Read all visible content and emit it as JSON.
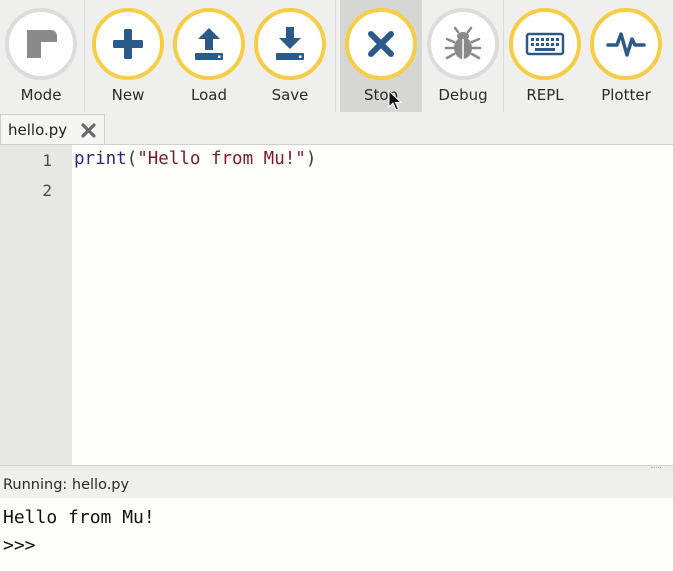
{
  "toolbar": {
    "buttons": [
      {
        "id": "mode",
        "label": "Mode",
        "icon": "mode-icon",
        "state": "gray-ring"
      },
      {
        "id": "new",
        "label": "New",
        "icon": "plus-icon",
        "state": "yellow-ring"
      },
      {
        "id": "load",
        "label": "Load",
        "icon": "upload-icon",
        "state": "yellow-ring"
      },
      {
        "id": "save",
        "label": "Save",
        "icon": "download-icon",
        "state": "yellow-ring"
      },
      {
        "id": "stop",
        "label": "Stop",
        "icon": "close-x-icon",
        "state": "yellow-ring, active"
      },
      {
        "id": "debug",
        "label": "Debug",
        "icon": "bug-icon",
        "state": "gray-ring, disabled"
      },
      {
        "id": "repl",
        "label": "REPL",
        "icon": "keyboard-icon",
        "state": "yellow-ring"
      },
      {
        "id": "plotter",
        "label": "Plotter",
        "icon": "pulse-icon",
        "state": "yellow-ring"
      }
    ]
  },
  "tabs": [
    {
      "label": "hello.py",
      "close_icon": "close-icon"
    }
  ],
  "editor": {
    "line_numbers": [
      "1",
      "2"
    ],
    "code": {
      "line1_keyword": "print",
      "line1_open": "(",
      "line1_string": "\"Hello from Mu!\"",
      "line1_close": ")"
    }
  },
  "output_pane": {
    "title": "Running: hello.py",
    "lines": [
      "Hello from Mu!",
      ">>>"
    ]
  },
  "colors": {
    "ring_yellow": "#f6cd47",
    "icon_blue": "#2b5a8a",
    "icon_gray": "#8a8a8a",
    "active_button_bg": "#d6d6d5",
    "editor_bg": "#fefefb",
    "gutter_bg": "#e7e7e4"
  }
}
